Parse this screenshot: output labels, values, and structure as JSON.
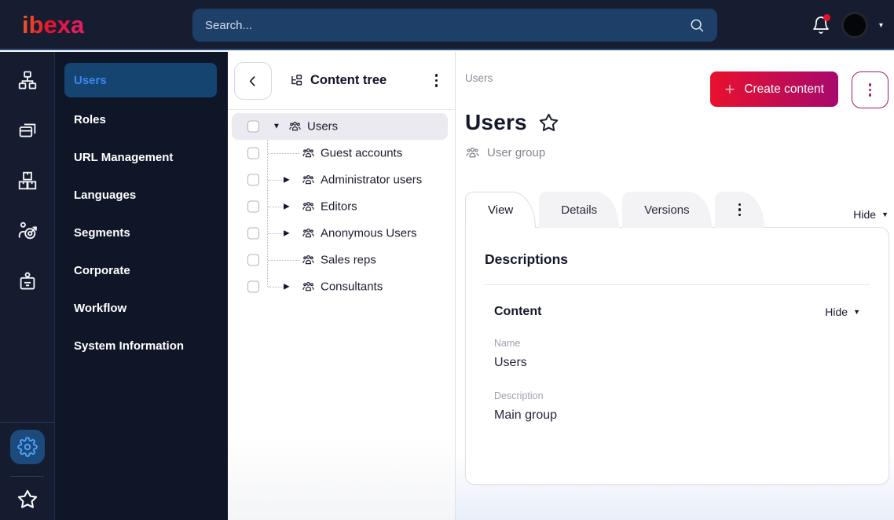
{
  "topbar": {
    "logo_text": "ibexa",
    "search_placeholder": "Search...",
    "icons": {
      "search": "magnifier-glyph",
      "notifications": "bell-glyph-with-red-dot",
      "user_menu": "avatar-circle-with-caret"
    }
  },
  "rail": {
    "icons": [
      "sitemap-icon",
      "content-cards-icon",
      "product-boxes-icon",
      "personalization-target-icon",
      "corporate-badge-icon",
      "settings-gear-icon",
      "favorites-star-icon"
    ],
    "active_icon": "settings-gear-icon"
  },
  "sidebar": {
    "items": [
      {
        "label": "Users",
        "selected": true
      },
      {
        "label": "Roles"
      },
      {
        "label": "URL Management"
      },
      {
        "label": "Languages"
      },
      {
        "label": "Segments"
      },
      {
        "label": "Corporate"
      },
      {
        "label": "Workflow"
      },
      {
        "label": "System Information"
      }
    ]
  },
  "content_tree": {
    "title": "Content tree",
    "items": [
      {
        "label": "Users",
        "state": "expanded",
        "selected": true,
        "depth": 0
      },
      {
        "label": "Guest accounts",
        "state": "leaf",
        "depth": 1
      },
      {
        "label": "Administrator users",
        "state": "collapsed",
        "depth": 1
      },
      {
        "label": "Editors",
        "state": "collapsed",
        "depth": 1
      },
      {
        "label": "Anonymous Users",
        "state": "collapsed",
        "depth": 1
      },
      {
        "label": "Sales reps",
        "state": "leaf",
        "depth": 1
      },
      {
        "label": "Consultants",
        "state": "collapsed",
        "depth": 1
      }
    ]
  },
  "main": {
    "breadcrumb": "Users",
    "create_button_label": "Create content",
    "title": "Users",
    "content_type_label": "User group",
    "tabs": [
      {
        "label": "View",
        "active": true
      },
      {
        "label": "Details"
      },
      {
        "label": "Versions"
      }
    ],
    "hide_toggle_label": "Hide",
    "card": {
      "heading": "Descriptions",
      "section_title": "Content",
      "section_hide_label": "Hide",
      "fields": [
        {
          "label": "Name",
          "value": "Users"
        },
        {
          "label": "Description",
          "value": "Main group"
        }
      ]
    }
  },
  "colors": {
    "topbar_bg": "#161d30",
    "topbar_border": "#2b4c7c",
    "search_bg": "#1e4068",
    "rail_bg": "#151c2f",
    "sidebar_bg": "#0f1628",
    "selected_menu_bg": "#164470",
    "selected_menu_text": "#3d85f4",
    "gear_active_bg": "#1b4a7b",
    "gear_active_icon": "#4da1f9",
    "accent_red": "#e8112d",
    "accent_magenta": "#a7096d",
    "tree_selected_bg": "#ebeaf0",
    "notification_dot": "#e8112d"
  }
}
